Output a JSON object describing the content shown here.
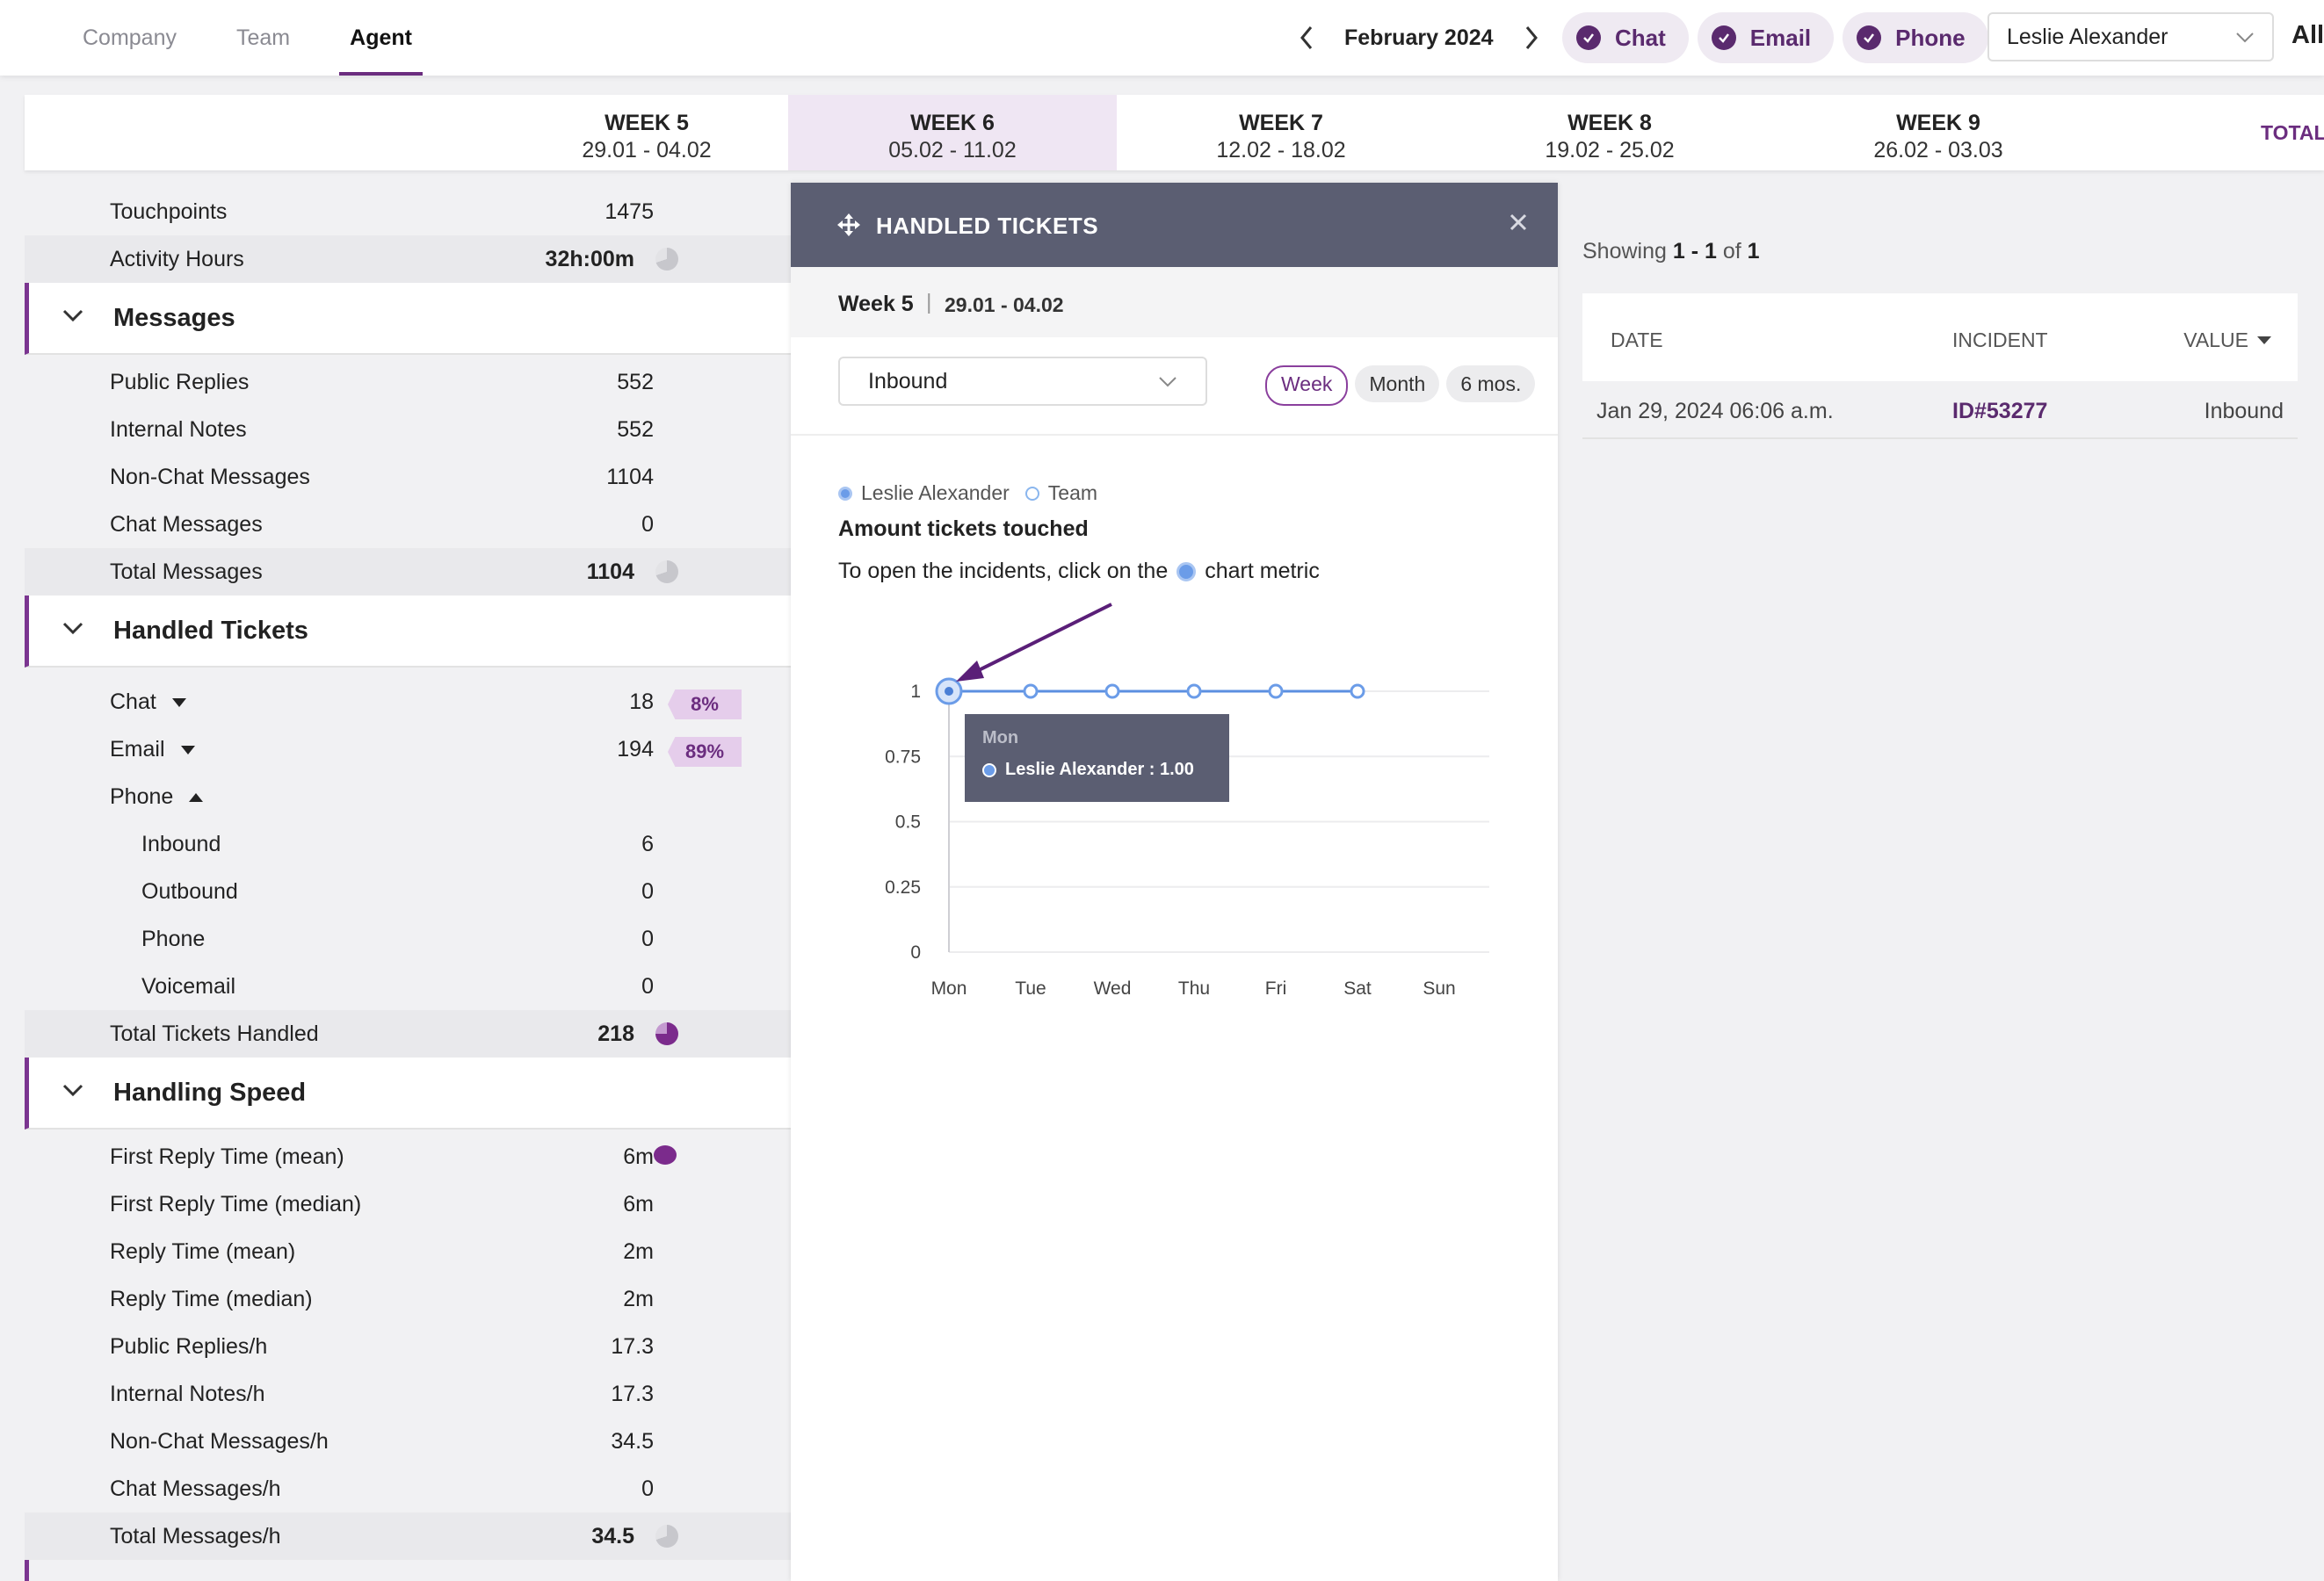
{
  "nav": {
    "tabs": [
      {
        "label": "Company"
      },
      {
        "label": "Team"
      },
      {
        "label": "Agent"
      }
    ],
    "period": "February 2024",
    "channels": [
      {
        "label": "Chat"
      },
      {
        "label": "Email"
      },
      {
        "label": "Phone"
      }
    ],
    "agent": "Leslie Alexander",
    "all_label": "All"
  },
  "weeks": [
    {
      "title": "WEEK 5",
      "range": "29.01 - 04.02"
    },
    {
      "title": "WEEK 6",
      "range": "05.02 - 11.02"
    },
    {
      "title": "WEEK 7",
      "range": "12.02 - 18.02"
    },
    {
      "title": "WEEK 8",
      "range": "19.02 - 25.02"
    },
    {
      "title": "WEEK 9",
      "range": "26.02 - 03.03"
    }
  ],
  "total_label": "TOTAL",
  "summary": {
    "touchpoints": {
      "label": "Touchpoints",
      "value": "1475"
    },
    "activity_hours": {
      "label": "Activity Hours",
      "value": "32h:00m"
    }
  },
  "messages": {
    "title": "Messages",
    "rows": [
      {
        "label": "Public Replies",
        "value": "552"
      },
      {
        "label": "Internal Notes",
        "value": "552"
      },
      {
        "label": "Non-Chat Messages",
        "value": "1104"
      },
      {
        "label": "Chat Messages",
        "value": "0"
      }
    ],
    "total": {
      "label": "Total Messages",
      "value": "1104"
    }
  },
  "handled": {
    "title": "Handled Tickets",
    "chat": {
      "label": "Chat",
      "value": "18",
      "badge": "8%"
    },
    "email": {
      "label": "Email",
      "value": "194",
      "badge": "89%"
    },
    "phone": {
      "label": "Phone"
    },
    "phone_rows": [
      {
        "label": "Inbound",
        "value": "6"
      },
      {
        "label": "Outbound",
        "value": "0"
      },
      {
        "label": "Phone",
        "value": "0"
      },
      {
        "label": "Voicemail",
        "value": "0"
      }
    ],
    "total": {
      "label": "Total Tickets Handled",
      "value": "218"
    }
  },
  "speed": {
    "title": "Handling Speed",
    "rows": [
      {
        "label": "First Reply Time (mean)",
        "value": "6m"
      },
      {
        "label": "First Reply Time (median)",
        "value": "6m"
      },
      {
        "label": "Reply Time (mean)",
        "value": "2m"
      },
      {
        "label": "Reply Time (median)",
        "value": "2m"
      },
      {
        "label": "Public Replies/h",
        "value": "17.3"
      },
      {
        "label": "Internal Notes/h",
        "value": "17.3"
      },
      {
        "label": "Non-Chat Messages/h",
        "value": "34.5"
      },
      {
        "label": "Chat Messages/h",
        "value": "0"
      }
    ],
    "total": {
      "label": "Total Messages/h",
      "value": "34.5"
    }
  },
  "popup": {
    "title": "HANDLED TICKETS",
    "week": "Week 5",
    "range": "29.01 - 04.02",
    "dropdown": "Inbound",
    "ranges": [
      "Week",
      "Month",
      "6 mos."
    ],
    "legend": [
      "Leslie Alexander",
      "Team"
    ],
    "chart_title": "Amount tickets touched",
    "hint_before": "To open the incidents, click on the",
    "hint_after": "chart metric",
    "tooltip": {
      "day": "Mon",
      "text": "Leslie Alexander :  1.00"
    }
  },
  "chart_data": {
    "type": "line",
    "title": "Amount tickets touched",
    "categories": [
      "Mon",
      "Tue",
      "Wed",
      "Thu",
      "Fri",
      "Sat",
      "Sun"
    ],
    "yticks": [
      "0",
      "0.25",
      "0.5",
      "0.75",
      "1"
    ],
    "ylim": [
      0,
      1
    ],
    "series": [
      {
        "name": "Leslie Alexander",
        "values": [
          1,
          1,
          1,
          1,
          1,
          1,
          null
        ],
        "color": "#5b8fe0"
      },
      {
        "name": "Team",
        "values": [],
        "color": "#8ab6ee"
      }
    ]
  },
  "incidents": {
    "showing_prefix": "Showing",
    "range": "1 - 1",
    "of_label": "of",
    "total": "1",
    "headers": [
      "DATE",
      "INCIDENT",
      "VALUE"
    ],
    "rows": [
      {
        "date": "Jan 29, 2024 06:06 a.m.",
        "incident": "ID#53277",
        "value": "Inbound"
      }
    ]
  },
  "colors": {
    "accent": "#6b2d7f",
    "header_dark": "#5b5e72",
    "line": "#5b8fe0"
  }
}
